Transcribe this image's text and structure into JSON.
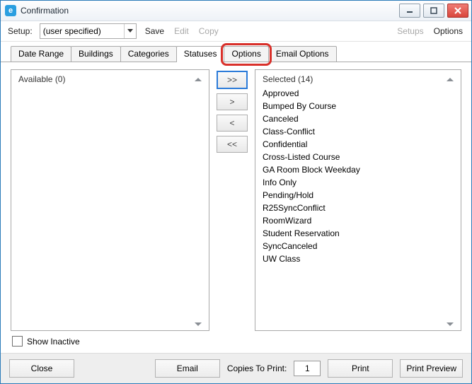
{
  "window": {
    "title": "Confirmation",
    "app_icon_letter": "e"
  },
  "toolbar": {
    "setup_label": "Setup:",
    "setup_value": "(user specified)",
    "save": "Save",
    "edit": "Edit",
    "copy": "Copy",
    "setups": "Setups",
    "options": "Options"
  },
  "tabs": {
    "date_range": "Date Range",
    "buildings": "Buildings",
    "categories": "Categories",
    "statuses": "Statuses",
    "options": "Options",
    "email_options": "Email Options"
  },
  "lists": {
    "available_label": "Available (0)",
    "selected_label": "Selected (14)",
    "selected_items": [
      "Approved",
      "Bumped By Course",
      "Canceled",
      "Class-Conflict",
      "Confidential",
      "Cross-Listed Course",
      "GA Room Block Weekday",
      "Info Only",
      "Pending/Hold",
      "R25SyncConflict",
      "RoomWizard",
      "Student Reservation",
      "SyncCanceled",
      "UW Class"
    ]
  },
  "move_btns": {
    "all_right": ">>",
    "right": ">",
    "left": "<",
    "all_left": "<<"
  },
  "show_inactive": "Show Inactive",
  "footer": {
    "close": "Close",
    "email": "Email",
    "copies_label": "Copies To Print:",
    "copies_value": "1",
    "print": "Print",
    "print_preview": "Print Preview"
  }
}
